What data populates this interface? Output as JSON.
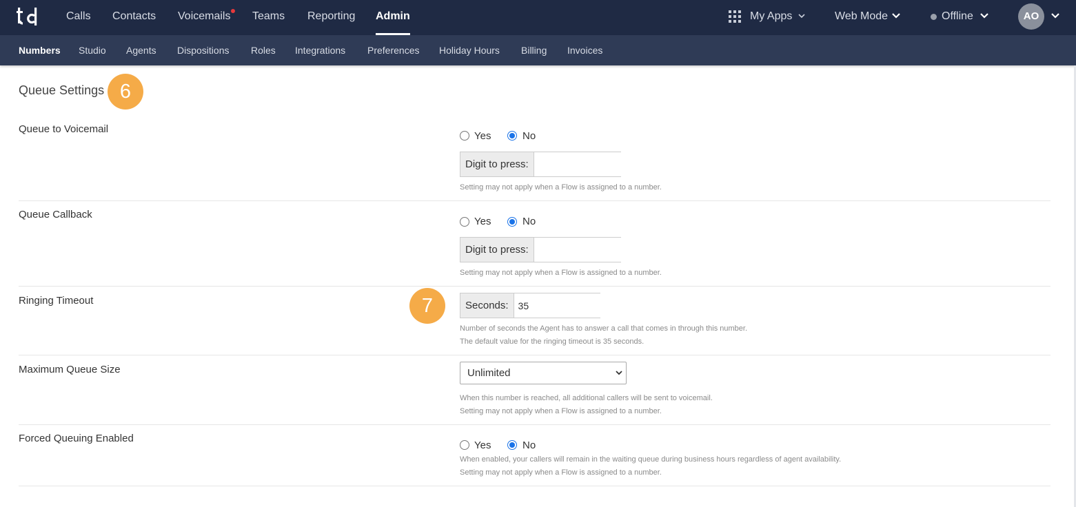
{
  "topnav": {
    "items": [
      {
        "label": "Calls"
      },
      {
        "label": "Contacts"
      },
      {
        "label": "Voicemails"
      },
      {
        "label": "Teams"
      },
      {
        "label": "Reporting"
      },
      {
        "label": "Admin"
      }
    ],
    "active": "Admin",
    "my_apps": "My Apps",
    "web_mode": "Web Mode",
    "status": "Offline",
    "avatar_initials": "AO",
    "colors": {
      "bar": "#1f2a44",
      "notification_dot": "#e8393b"
    }
  },
  "subnav": {
    "items": [
      {
        "label": "Numbers"
      },
      {
        "label": "Studio"
      },
      {
        "label": "Agents"
      },
      {
        "label": "Dispositions"
      },
      {
        "label": "Roles"
      },
      {
        "label": "Integrations"
      },
      {
        "label": "Preferences"
      },
      {
        "label": "Holiday Hours"
      },
      {
        "label": "Billing"
      },
      {
        "label": "Invoices"
      }
    ],
    "active": "Numbers"
  },
  "section": {
    "title": "Queue Settings",
    "markers": [
      "6",
      "7"
    ],
    "marker_color": "#f5ab48"
  },
  "settings": {
    "queue_to_voicemail": {
      "label": "Queue to Voicemail",
      "yes_label": "Yes",
      "no_label": "No",
      "selected": "No",
      "digit_label": "Digit to press:",
      "digit_value": "",
      "help": "Setting may not apply when a Flow is assigned to a number."
    },
    "queue_callback": {
      "label": "Queue Callback",
      "yes_label": "Yes",
      "no_label": "No",
      "selected": "No",
      "digit_label": "Digit to press:",
      "digit_value": "",
      "help": "Setting may not apply when a Flow is assigned to a number."
    },
    "ringing_timeout": {
      "label": "Ringing Timeout",
      "seconds_label": "Seconds:",
      "seconds_value": "35",
      "help_1": "Number of seconds the Agent has to answer a call that comes in through this number.",
      "help_2": "The default value for the ringing timeout is 35 seconds."
    },
    "maximum_queue_size": {
      "label": "Maximum Queue Size",
      "selected_option": "Unlimited",
      "help_1": "When this number is reached, all additional callers will be sent to voicemail.",
      "help_2": "Setting may not apply when a Flow is assigned to a number."
    },
    "forced_queuing": {
      "label": "Forced Queuing Enabled",
      "yes_label": "Yes",
      "no_label": "No",
      "selected": "No",
      "help_1": "When enabled, your callers will remain in the waiting queue during business hours regardless of agent availability.",
      "help_2": "Setting may not apply when a Flow is assigned to a number."
    }
  }
}
